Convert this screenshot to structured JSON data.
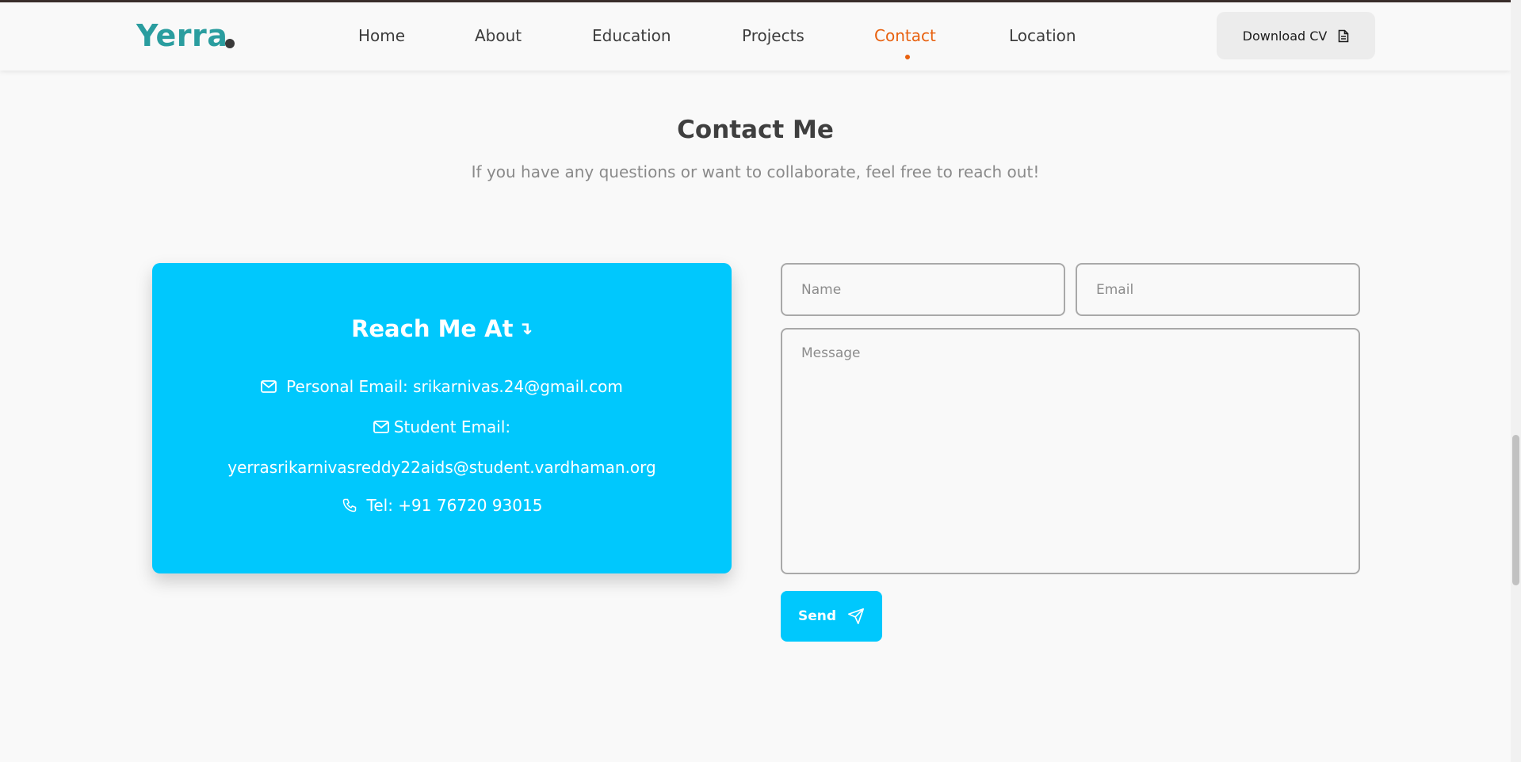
{
  "nav": {
    "logo": "Yerra",
    "items": [
      {
        "label": "Home",
        "active": false
      },
      {
        "label": "About",
        "active": false
      },
      {
        "label": "Education",
        "active": false
      },
      {
        "label": "Projects",
        "active": false
      },
      {
        "label": "Contact",
        "active": true
      },
      {
        "label": "Location",
        "active": false
      }
    ],
    "cv_button": "Download CV"
  },
  "contact": {
    "title": "Contact Me",
    "subtitle": "If you have any questions or want to collaborate, feel free to reach out!"
  },
  "card": {
    "title": "Reach Me At",
    "title_arrow": "↴",
    "personal_email": "Personal Email: srikarnivas.24@gmail.com",
    "student_email_label": "Student Email:",
    "student_email": "yerrasrikarnivasreddy22aids@student.vardhaman.org",
    "phone": "Tel: +91 76720 93015"
  },
  "form": {
    "name_placeholder": "Name",
    "email_placeholder": "Email",
    "message_placeholder": "Message",
    "send_label": "Send"
  },
  "colors": {
    "accent": "#00c8fd",
    "logo": "#2a9d9f",
    "active_nav": "#e8610f"
  },
  "icons": [
    "document-icon",
    "mail-icon",
    "phone-icon",
    "send-icon"
  ]
}
